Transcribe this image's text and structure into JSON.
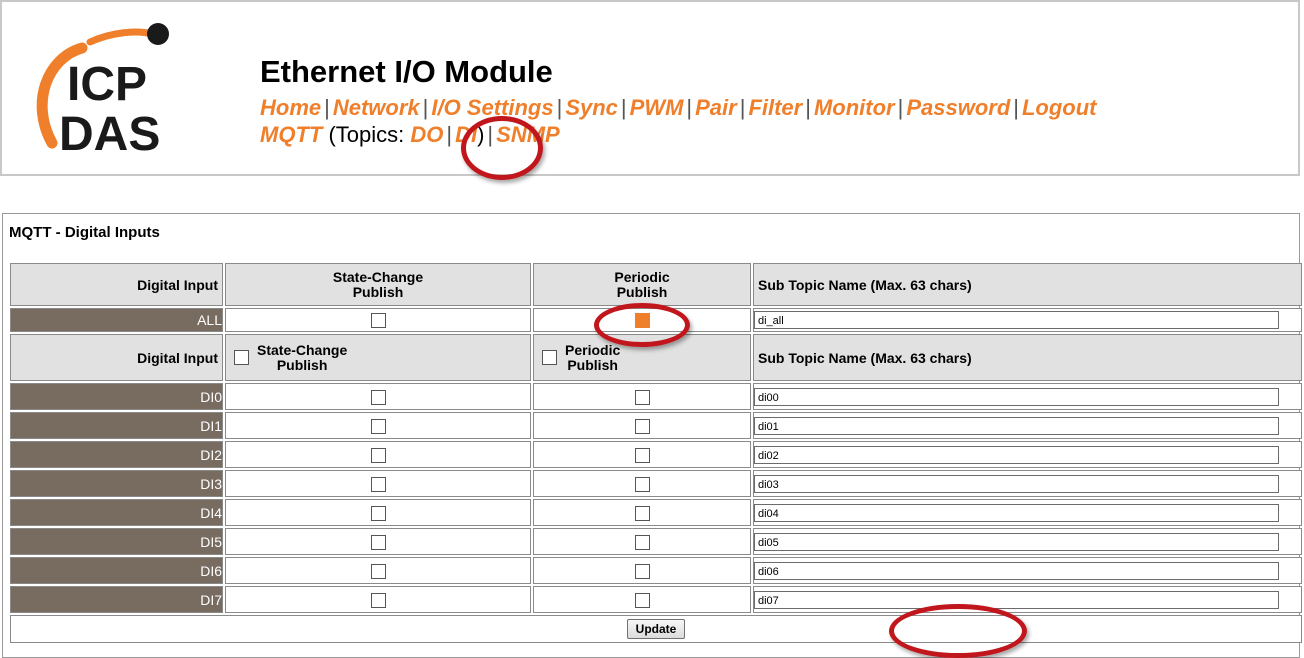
{
  "header": {
    "logo_text_top": "ICP",
    "logo_text_bottom": "DAS",
    "title": "Ethernet I/O Module",
    "nav": [
      {
        "label": "Home"
      },
      {
        "label": "Network"
      },
      {
        "label": "I/O Settings"
      },
      {
        "label": "Sync"
      },
      {
        "label": "PWM"
      },
      {
        "label": "Pair"
      },
      {
        "label": "Filter"
      },
      {
        "label": "Monitor"
      },
      {
        "label": "Password"
      },
      {
        "label": "Logout"
      }
    ],
    "mqtt": {
      "label": "MQTT",
      "topics_prefix": "(Topics: ",
      "topic_do": "DO",
      "topic_di": "DI",
      "topics_suffix": ")",
      "snmp": "SNMP"
    },
    "separator": "|"
  },
  "panel": {
    "title": "MQTT - Digital Inputs",
    "columns": {
      "digital_input": "Digital Input",
      "state_change": "State-Change",
      "state_change_2": "Publish",
      "periodic": "Periodic",
      "periodic_2": "Publish",
      "sub_topic": "Sub Topic Name (Max. 63 chars)"
    },
    "all_row": {
      "label": "ALL",
      "state_change_checked": false,
      "periodic_checked": true,
      "topic": "di_all"
    },
    "rows": [
      {
        "label": "DI0",
        "topic": "di00"
      },
      {
        "label": "DI1",
        "topic": "di01"
      },
      {
        "label": "DI2",
        "topic": "di02"
      },
      {
        "label": "DI3",
        "topic": "di03"
      },
      {
        "label": "DI4",
        "topic": "di04"
      },
      {
        "label": "DI5",
        "topic": "di05"
      },
      {
        "label": "DI6",
        "topic": "di06"
      },
      {
        "label": "DI7",
        "topic": "di07"
      }
    ],
    "update_label": "Update"
  },
  "colors": {
    "accent": "#ef7f2b",
    "row_label_bg": "#786b5f",
    "header_bg": "#e1e1e1",
    "annotation": "#c0161c"
  }
}
